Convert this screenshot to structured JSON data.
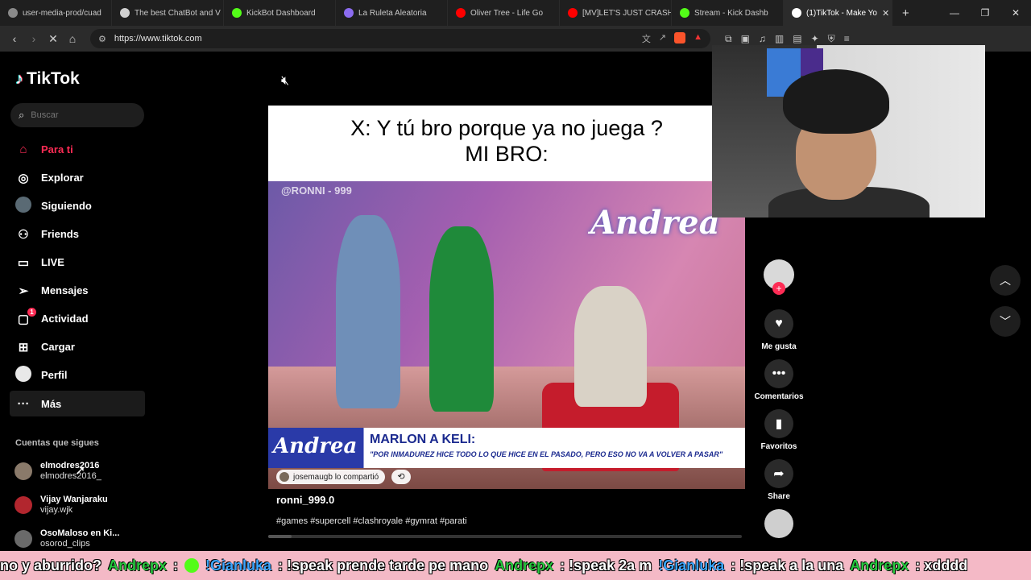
{
  "browser": {
    "tabs": [
      {
        "title": "user-media-prod/cuad",
        "color": "#8a8a8a"
      },
      {
        "title": "The best ChatBot and V",
        "color": "#d0d0d0"
      },
      {
        "title": "KickBot Dashboard",
        "color": "#53fc18"
      },
      {
        "title": "La Ruleta Aleatoria",
        "color": "#8c6cf0"
      },
      {
        "title": "Oliver Tree - Life Go",
        "color": "#ff0000"
      },
      {
        "title": "[MV]LET'S JUST CRASH",
        "color": "#ff0000"
      },
      {
        "title": "Stream - Kick Dashb",
        "color": "#53fc18"
      },
      {
        "title": "(1)TikTok - Make Yo",
        "color": "#ffffff"
      }
    ],
    "new_tab": "+",
    "url": "https://www.tiktok.com"
  },
  "sidebar": {
    "logo": "TikTok",
    "search_placeholder": "Buscar",
    "nav": [
      {
        "label": "Para ti",
        "icon": "home-icon",
        "glyph": "⌂"
      },
      {
        "label": "Explorar",
        "icon": "compass-icon",
        "glyph": "◎"
      },
      {
        "label": "Siguiendo",
        "icon": "avatar-icon",
        "glyph": ""
      },
      {
        "label": "Friends",
        "icon": "friends-icon",
        "glyph": "⚇"
      },
      {
        "label": "LIVE",
        "icon": "live-icon",
        "glyph": "▭"
      },
      {
        "label": "Mensajes",
        "icon": "send-icon",
        "glyph": "➢"
      },
      {
        "label": "Actividad",
        "icon": "activity-icon",
        "glyph": "▢",
        "badge": "1"
      },
      {
        "label": "Cargar",
        "icon": "upload-icon",
        "glyph": "⊞"
      },
      {
        "label": "Perfil",
        "icon": "profile-icon",
        "glyph": ""
      },
      {
        "label": "Más",
        "icon": "more-icon",
        "glyph": "···"
      }
    ],
    "following_title": "Cuentas que sigues",
    "following": [
      {
        "name": "elmodres2016",
        "handle": "elmodres2016_",
        "color": "#8a7a6a"
      },
      {
        "name": "Vijay Wanjaraku",
        "handle": "vijay.wjk",
        "color": "#b2262e"
      },
      {
        "name": "OsoMaloso en Ki...",
        "handle": "osorod_clips",
        "color": "#6a6a6a"
      }
    ]
  },
  "video": {
    "caption_line1": "X: Y tú bro porque ya no juega ?",
    "caption_line2": "MI BRO:",
    "watermark": "@RONNI - 999",
    "show_logo": "Andrea",
    "lower_third_logo": "Andrea",
    "lower_third_title": "MARLON A KELI:",
    "lower_third_sub": "\"POR INMADUREZ HICE TODO LO QUE HICE EN EL PASADO, PERO ESO NO VA A VOLVER A PASAR\"",
    "shared_by": "josemaugb lo compartió",
    "author": "ronni_999.0",
    "tags": "#games #supercell #clashroyale #gymrat #parati",
    "progress": 0.05
  },
  "actions": {
    "like": "Me gusta",
    "comments": "Comentarios",
    "favorites": "Favoritos",
    "share": "Share"
  },
  "ticker": {
    "segments": [
      {
        "type": "text",
        "value": "no y aburrido?"
      },
      {
        "type": "user1",
        "value": "Andrepx"
      },
      {
        "type": "text",
        "value": ":"
      },
      {
        "type": "emote",
        "value": ""
      },
      {
        "type": "user2",
        "value": "!Gianluka"
      },
      {
        "type": "text",
        "value": ": !speak prende tarde pe mano"
      },
      {
        "type": "user1",
        "value": "Andrepx"
      },
      {
        "type": "text",
        "value": ": !speak 2a m"
      },
      {
        "type": "user2",
        "value": "!Gianluka"
      },
      {
        "type": "text",
        "value": ": !speak a la una"
      },
      {
        "type": "user1",
        "value": "Andrepx"
      },
      {
        "type": "text",
        "value": ": xdddd"
      }
    ]
  }
}
